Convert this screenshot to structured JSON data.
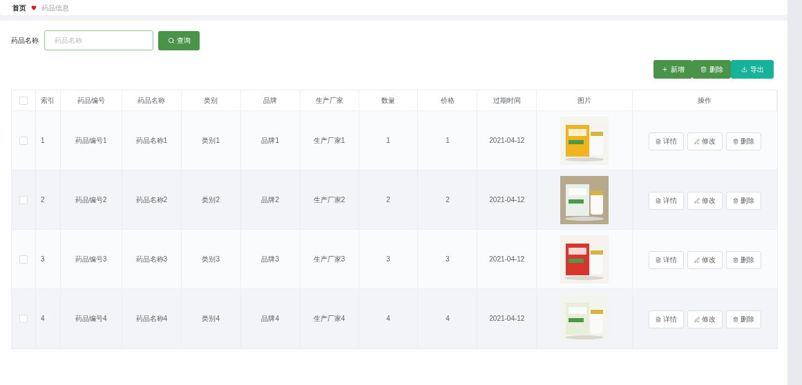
{
  "breadcrumb": {
    "home": "首页",
    "current": "药品信息"
  },
  "search": {
    "label": "药品名称",
    "placeholder": "药品名称",
    "button": "查询"
  },
  "actions": [
    {
      "kind": "add",
      "label": "新增"
    },
    {
      "kind": "delete",
      "label": "删除"
    },
    {
      "kind": "export",
      "label": "导出"
    }
  ],
  "table": {
    "columns": [
      "索引",
      "药品编号",
      "药品名称",
      "类别",
      "品牌",
      "生产厂家",
      "数量",
      "价格",
      "过期时间",
      "图片",
      "操作"
    ],
    "header_checked": false,
    "rows": [
      {
        "checked": false,
        "cells": [
          "1",
          "药品编号1",
          "药品名称1",
          "类别1",
          "品牌1",
          "生产厂家1",
          "1",
          "1",
          "2021-04-12"
        ],
        "image": {
          "kind": "picture"
        },
        "buttons": [
          {
            "kind": "detail",
            "label": "详情"
          },
          {
            "kind": "edit",
            "label": "修改"
          },
          {
            "kind": "delete",
            "label": "删除"
          }
        ]
      },
      {
        "checked": false,
        "cells": [
          "2",
          "药品编号2",
          "药品名称2",
          "类别2",
          "品牌2",
          "生产厂家2",
          "2",
          "2",
          "2021-04-12"
        ],
        "image": {
          "kind": "picture"
        },
        "buttons": [
          {
            "kind": "detail",
            "label": "详情"
          },
          {
            "kind": "edit",
            "label": "修改"
          },
          {
            "kind": "delete",
            "label": "删除"
          }
        ]
      },
      {
        "checked": false,
        "cells": [
          "3",
          "药品编号3",
          "药品名称3",
          "类别3",
          "品牌3",
          "生产厂家3",
          "3",
          "3",
          "2021-04-12"
        ],
        "image": {
          "kind": "picture"
        },
        "buttons": [
          {
            "kind": "detail",
            "label": "详情"
          },
          {
            "kind": "edit",
            "label": "修改"
          },
          {
            "kind": "delete",
            "label": "删除"
          }
        ]
      },
      {
        "checked": false,
        "cells": [
          "4",
          "药品编号4",
          "药品名称4",
          "类别4",
          "品牌4",
          "生产厂家4",
          "4",
          "4",
          "2021-04-12"
        ],
        "image": {
          "kind": "picture"
        },
        "buttons": [
          {
            "kind": "detail",
            "label": "详情"
          },
          {
            "kind": "edit",
            "label": "修改"
          },
          {
            "kind": "delete",
            "label": "删除"
          }
        ]
      }
    ]
  }
}
